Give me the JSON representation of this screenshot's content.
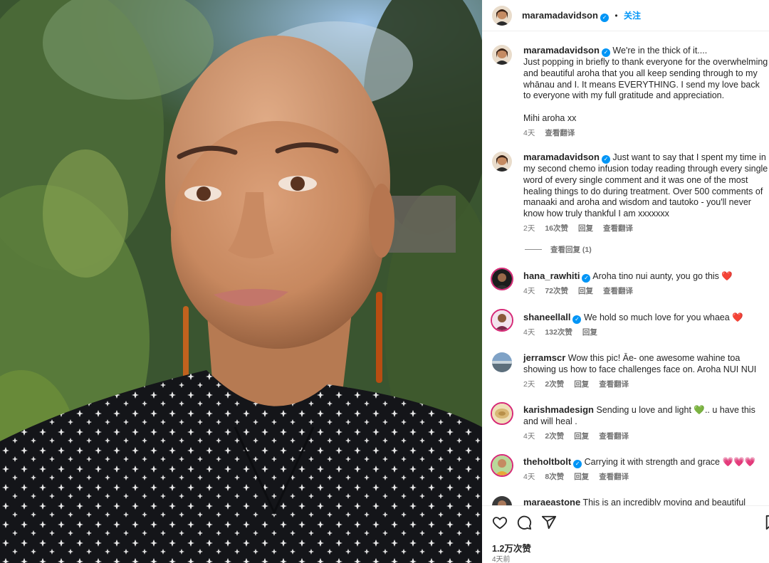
{
  "post": {
    "author": "maramadavidson",
    "follow_label": "关注",
    "dot": "•"
  },
  "comments": [
    {
      "user": "maramadavidson",
      "verified": true,
      "text": "We're in the thick of it....\nJust popping in briefly to thank everyone for the overwhelming and beautiful aroha that you all keep sending through to my whānau and I. It means EVERYTHING. I send my love back to everyone with my full gratitude and appreciation.\n\nMihi aroha xx",
      "time": "4天",
      "likes": "",
      "reply": "",
      "translate": "查看翻译"
    },
    {
      "user": "maramadavidson",
      "verified": true,
      "text": "Just want to say that I spent my time in my second chemo infusion today reading through every single word of every single comment and it was one of the most healing things to do during treatment. Over 500 comments of manaaki and aroha and wisdom and tautoko - you'll never know how truly thankful I am xxxxxxx",
      "time": "2天",
      "likes": "16次赞",
      "reply": "回复",
      "translate": "查看翻译"
    },
    {
      "user": "hana_rawhiti",
      "verified": true,
      "text": "Aroha tino nui aunty, you go this ❤️",
      "time": "4天",
      "likes": "72次赞",
      "reply": "回复",
      "translate": "查看翻译"
    },
    {
      "user": "shaneellall",
      "verified": true,
      "text": "We hold so much love for you whaea ❤️",
      "time": "4天",
      "likes": "132次赞",
      "reply": "回复",
      "translate": ""
    },
    {
      "user": "jerramscr",
      "verified": false,
      "text": "Wow this pic! Āe- one awesome wahine toa showing us how to face challenges face on. Aroha NUI NUI",
      "time": "2天",
      "likes": "2次赞",
      "reply": "回复",
      "translate": "查看翻译"
    },
    {
      "user": "karishmadesign",
      "verified": false,
      "text": "Sending u love and light 💚.. u have this and will heal .",
      "time": "4天",
      "likes": "2次赞",
      "reply": "回复",
      "translate": "查看翻译"
    },
    {
      "user": "theholtbolt",
      "verified": true,
      "text": "Carrying it with strength and grace 💗💗💗",
      "time": "4天",
      "likes": "8次赞",
      "reply": "回复",
      "translate": "查看翻译"
    },
    {
      "user": "maraeastone",
      "verified": false,
      "text": "This is an incredibly moving and beautiful",
      "time": "",
      "likes": "",
      "reply": "",
      "translate": ""
    }
  ],
  "view_replies": "查看回复 (1)",
  "footer": {
    "likes": "1.2万次赞",
    "time": "4天前"
  },
  "colors": {
    "accent": "#0095f6",
    "muted": "#737373",
    "text": "#262626"
  },
  "icons": [
    "heart-icon",
    "comment-icon",
    "share-icon",
    "bookmark-icon",
    "verified-icon"
  ]
}
